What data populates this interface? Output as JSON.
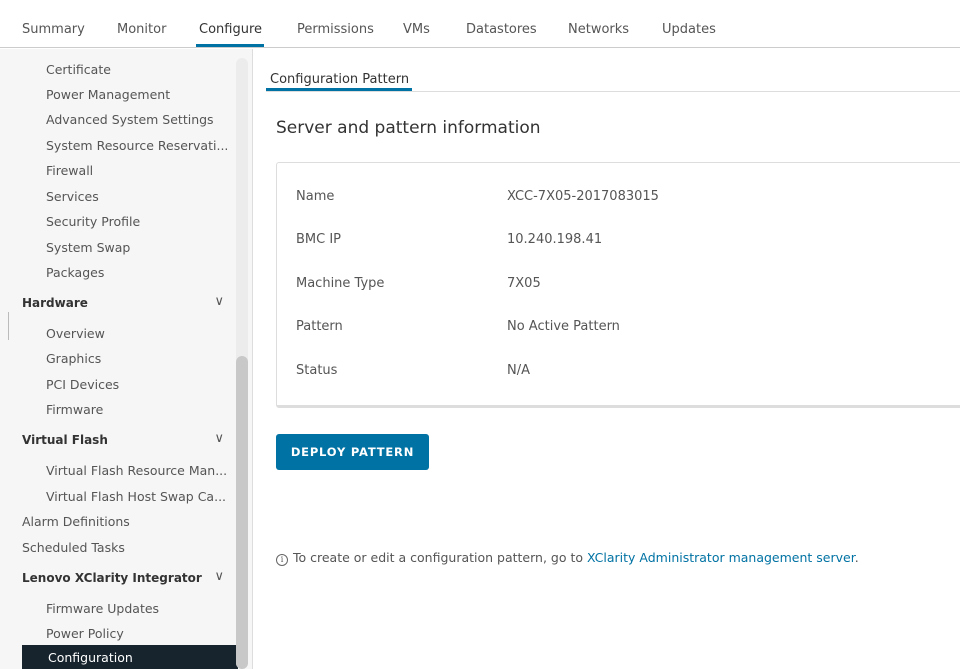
{
  "top_tabs": [
    {
      "label": "Summary"
    },
    {
      "label": "Monitor"
    },
    {
      "label": "Configure"
    },
    {
      "label": "Permissions"
    },
    {
      "label": "VMs"
    },
    {
      "label": "Datastores"
    },
    {
      "label": "Networks"
    },
    {
      "label": "Updates"
    }
  ],
  "sidebar": {
    "items_top": [
      "Certificate",
      "Power Management",
      "Advanced System Settings",
      "System Resource Reservati...",
      "Firewall",
      "Services",
      "Security Profile",
      "System Swap",
      "Packages"
    ],
    "hardware": {
      "label": "Hardware",
      "items": [
        "Overview",
        "Graphics",
        "PCI Devices",
        "Firmware"
      ]
    },
    "virtual_flash": {
      "label": "Virtual Flash",
      "items": [
        "Virtual Flash Resource Man...",
        "Virtual Flash Host Swap Ca..."
      ]
    },
    "alarm_definitions": "Alarm Definitions",
    "scheduled_tasks": "Scheduled Tasks",
    "xclarity": {
      "label": "Lenovo XClarity Integrator",
      "items": [
        "Firmware Updates",
        "Power Policy",
        "Configuration"
      ]
    },
    "chevron": "∨"
  },
  "main": {
    "sub_tab": "Configuration Pattern",
    "section_title": "Server and pattern information",
    "rows": [
      {
        "label": "Name",
        "value": "XCC-7X05-2017083015"
      },
      {
        "label": "BMC IP",
        "value": "10.240.198.41"
      },
      {
        "label": "Machine Type",
        "value": "7X05"
      },
      {
        "label": "Pattern",
        "value": "No Active Pattern"
      },
      {
        "label": "Status",
        "value": "N/A"
      }
    ],
    "deploy_button": "DEPLOY PATTERN",
    "info_icon": "i",
    "info_text": "To create or edit a configuration pattern, go to ",
    "info_link": "XClarity Administrator management server",
    "info_end": "."
  },
  "colors": {
    "accent": "#0072a3",
    "active_nav_bg": "#17242d"
  }
}
